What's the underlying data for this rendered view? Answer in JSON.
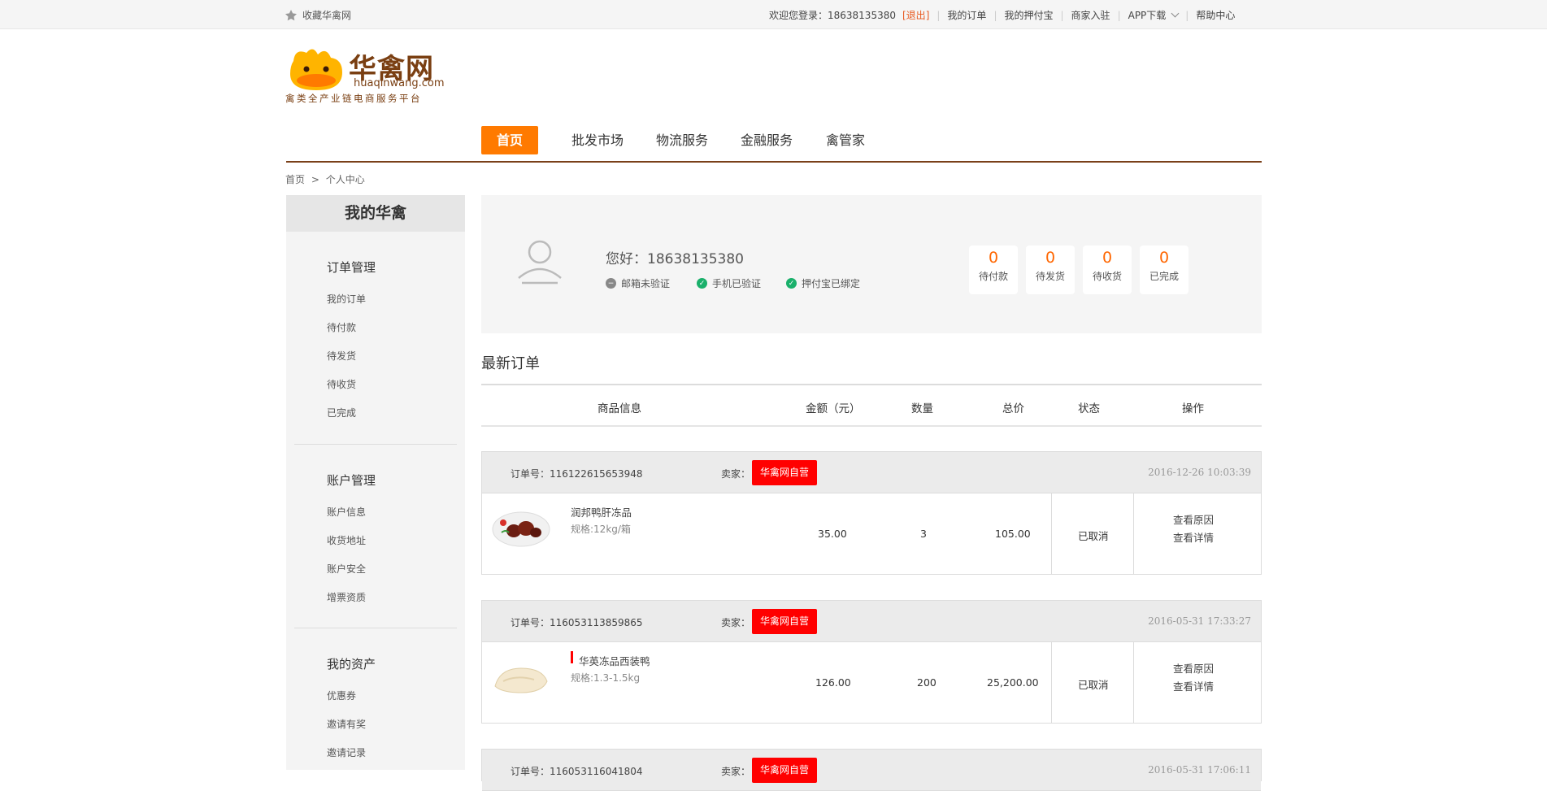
{
  "topbar": {
    "favorite": "收藏华禽网",
    "welcome": "欢迎您登录：18638135380",
    "logout": "退出",
    "links": [
      "我的订单",
      "我的押付宝",
      "商家入驻",
      "APP下载",
      "帮助中心"
    ]
  },
  "logo": {
    "title": "华禽网",
    "domain": "huaqinwang.com",
    "slogan": "禽类全产业链电商服务平台"
  },
  "nav": {
    "items": [
      "首页",
      "批发市场",
      "物流服务",
      "金融服务",
      "禽管家"
    ],
    "active": "首页"
  },
  "breadcrumb": {
    "home": "首页",
    "sep": ">",
    "current": "个人中心"
  },
  "sidebar": {
    "title": "我的华禽",
    "groups": [
      {
        "title": "订单管理",
        "items": [
          "我的订单",
          "待付款",
          "待发货",
          "待收货",
          "已完成"
        ]
      },
      {
        "title": "账户管理",
        "items": [
          "账户信息",
          "收货地址",
          "账户安全",
          "增票资质"
        ]
      },
      {
        "title": "我的资产",
        "items": [
          "优惠券",
          "邀请有奖",
          "邀请记录"
        ]
      }
    ]
  },
  "profile": {
    "greeting": "您好：18638135380",
    "verifications": [
      {
        "label": "邮箱未验证",
        "status": "unverified"
      },
      {
        "label": "手机已验证",
        "status": "verified"
      },
      {
        "label": "押付宝已绑定",
        "status": "verified"
      }
    ],
    "stats": [
      {
        "count": "0",
        "label": "待付款"
      },
      {
        "count": "0",
        "label": "待发货"
      },
      {
        "count": "0",
        "label": "待收货"
      },
      {
        "count": "0",
        "label": "已完成"
      }
    ]
  },
  "orders_section": {
    "title": "最新订单",
    "columns": [
      "商品信息",
      "金额（元）",
      "数量",
      "总价",
      "状态",
      "操作"
    ]
  },
  "orders": [
    {
      "order_no_label": "订单号：",
      "order_no": "116122615653948",
      "seller_label": "卖家：",
      "seller": "华禽网自营",
      "time": "2016-12-26 10:03:39",
      "product": "润邦鸭肝冻品",
      "spec": "规格:12kg/箱",
      "price": "35.00",
      "qty": "3",
      "total": "105.00",
      "status": "已取消",
      "op1": "查看原因",
      "op2": "查看详情"
    },
    {
      "order_no_label": "订单号：",
      "order_no": "116053113859865",
      "seller_label": "卖家：",
      "seller": "华禽网自营",
      "time": "2016-05-31 17:33:27",
      "product": "华英冻品西装鸭",
      "spec": "规格:1.3-1.5kg",
      "price": "126.00",
      "qty": "200",
      "total": "25,200.00",
      "status": "已取消",
      "op1": "查看原因",
      "op2": "查看详情"
    },
    {
      "order_no_label": "订单号：",
      "order_no": "116053116041804",
      "seller_label": "卖家：",
      "seller": "华禽网自营",
      "time": "2016-05-31 17:06:11"
    }
  ],
  "colors": {
    "accent": "#ff7a00",
    "brand": "#7a3f12",
    "tag": "#ff0000",
    "verified": "#1ab06b"
  }
}
